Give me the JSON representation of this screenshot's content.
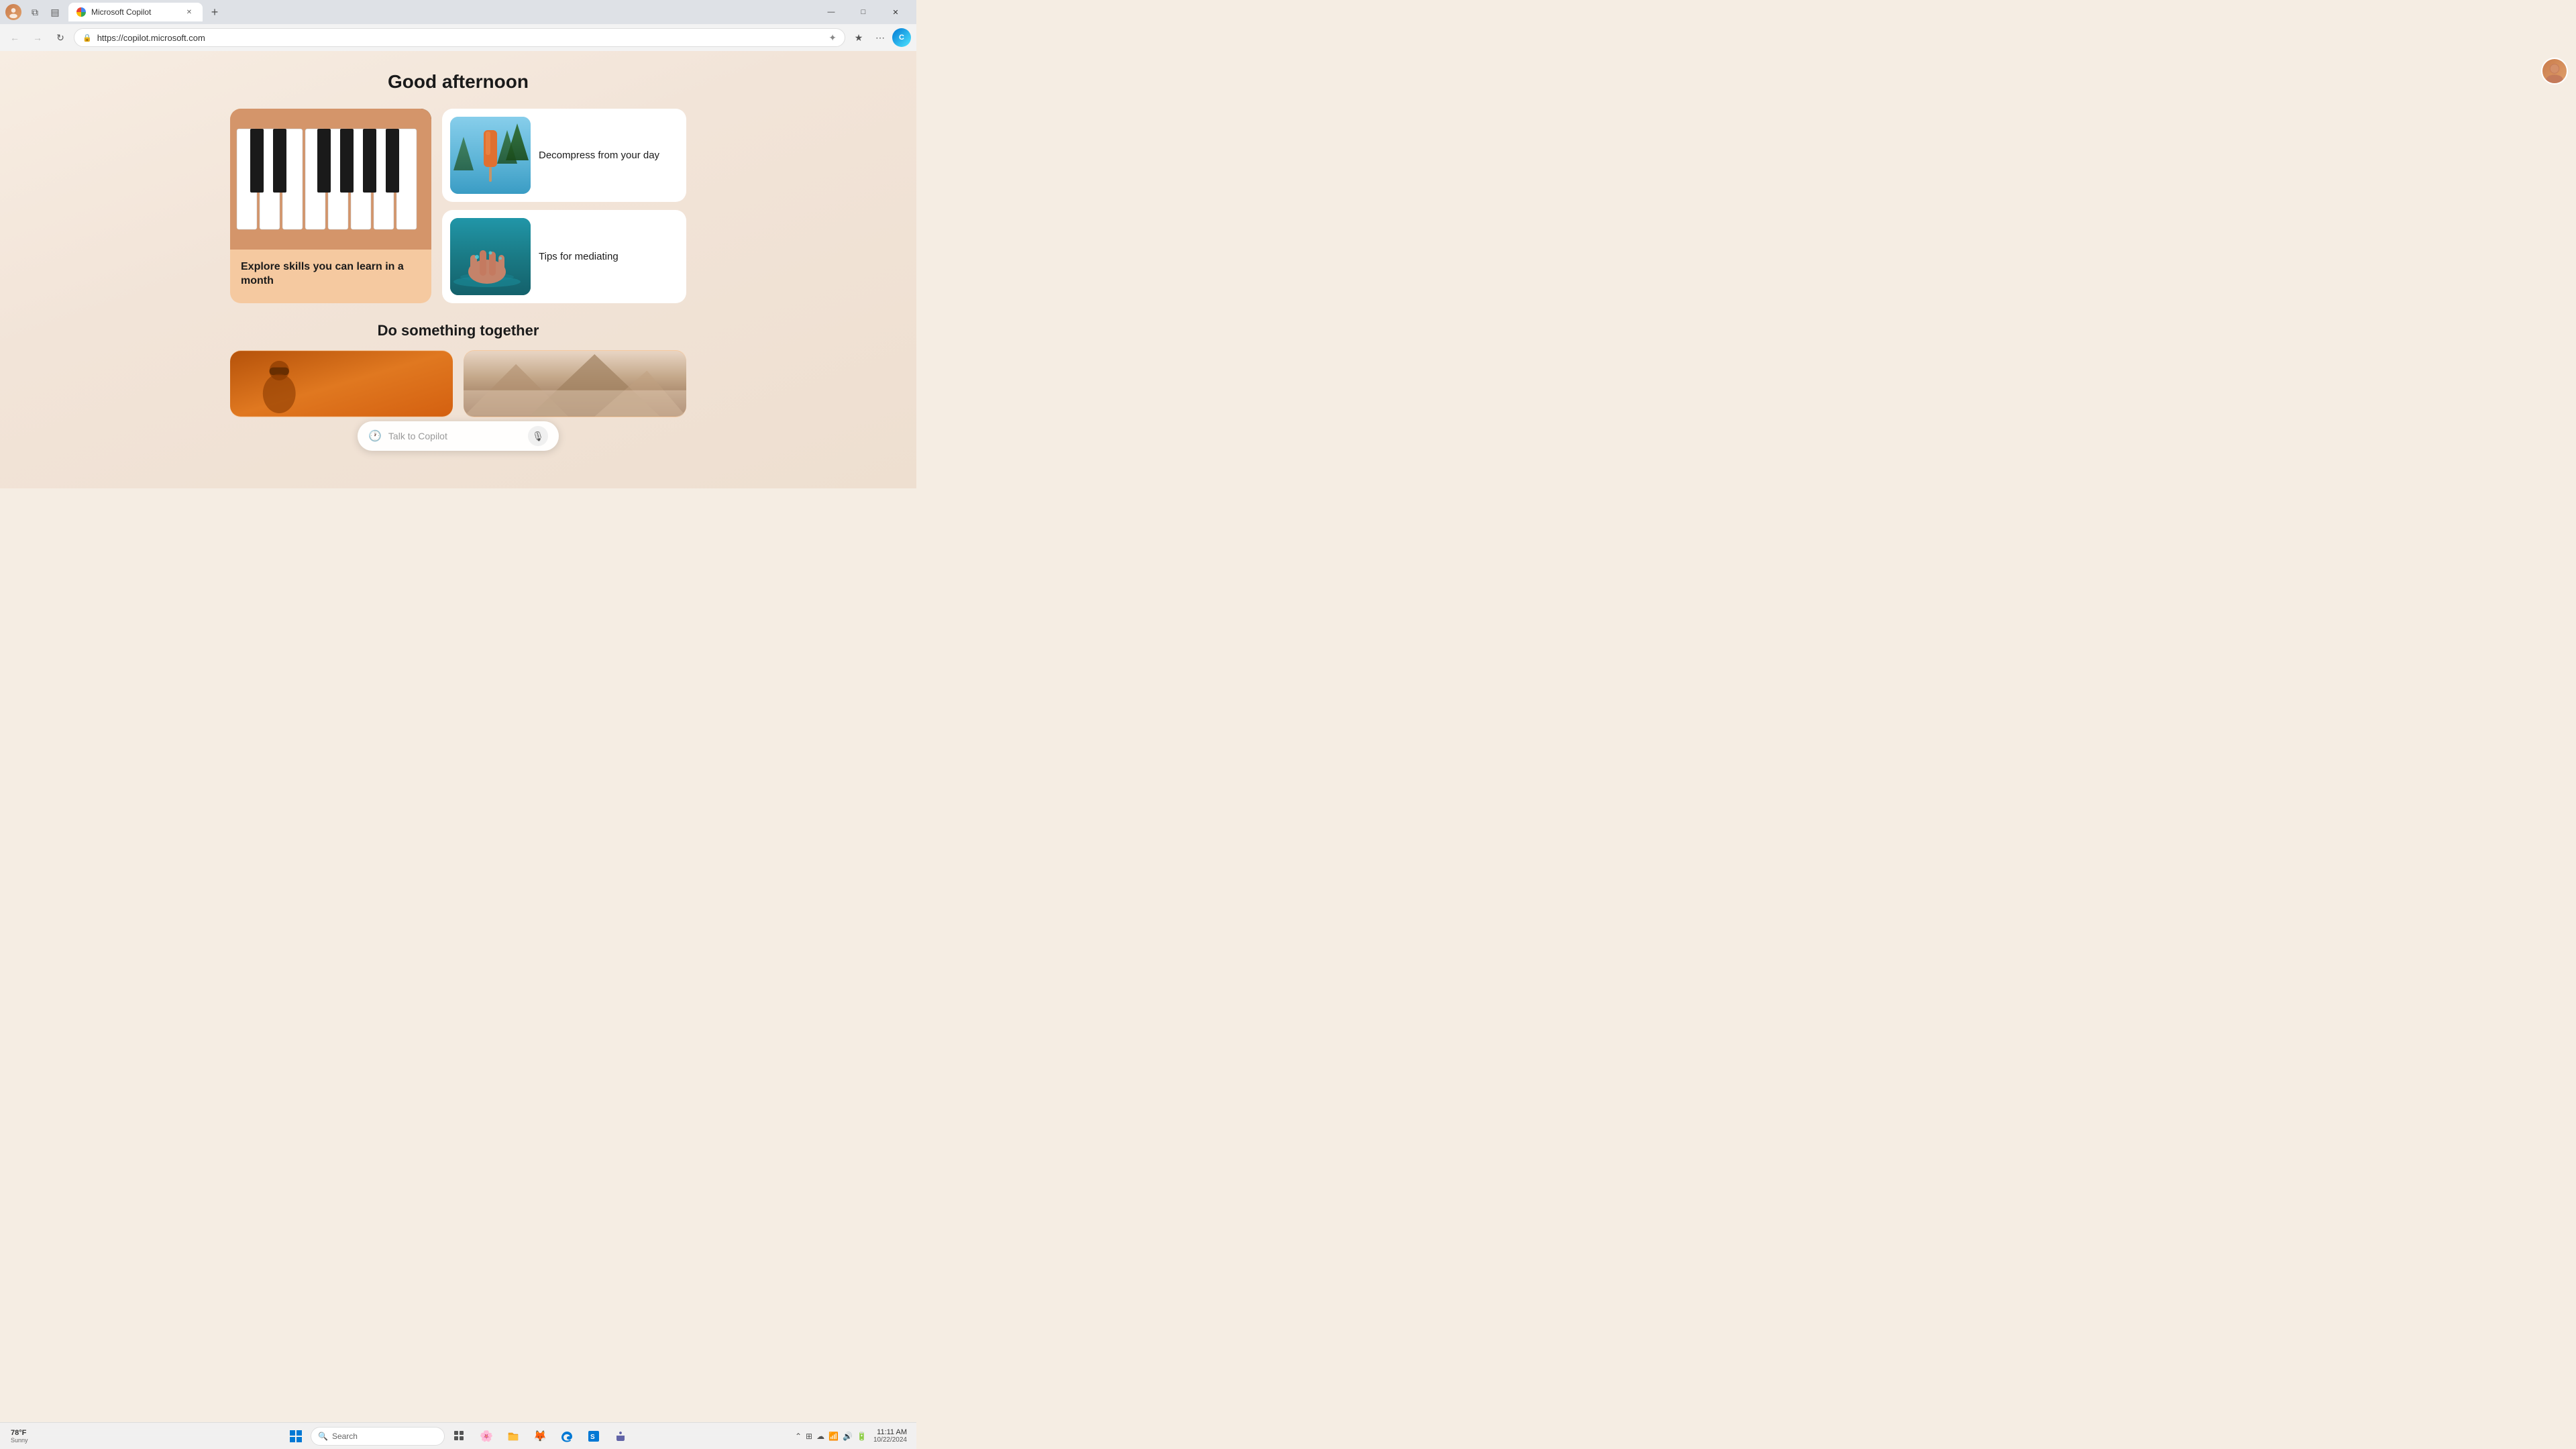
{
  "browser": {
    "tab_label": "Microsoft Copilot",
    "tab_favicon": "copilot-favicon",
    "url": "https://copilot.microsoft.com",
    "new_tab_label": "+",
    "window_controls": {
      "minimize": "—",
      "maximize": "□",
      "close": "✕"
    },
    "nav": {
      "back": "←",
      "forward": "→",
      "refresh": "↻",
      "home": "⌂"
    },
    "address_bar_actions": {
      "copilot": "✦",
      "favorites": "★",
      "more": "⋯",
      "edge_copilot": "C"
    }
  },
  "page": {
    "greeting": "Good afternoon",
    "cards": [
      {
        "id": "piano",
        "label": "Explore skills you can learn in a month",
        "type": "large"
      },
      {
        "id": "popsicle",
        "label": "Decompress from your day",
        "type": "small"
      },
      {
        "id": "water",
        "label": "Tips for mediating",
        "type": "small"
      }
    ],
    "section2_title": "Do something together",
    "copilot_bar": {
      "placeholder": "Talk to Copilot"
    }
  },
  "user_avatar": {
    "alt": "User profile"
  },
  "taskbar": {
    "weather": {
      "temp": "78°F",
      "condition": "Sunny"
    },
    "search_placeholder": "Search",
    "system_tray": {
      "time": "11:11 AM",
      "date": "10/22/2024"
    }
  }
}
